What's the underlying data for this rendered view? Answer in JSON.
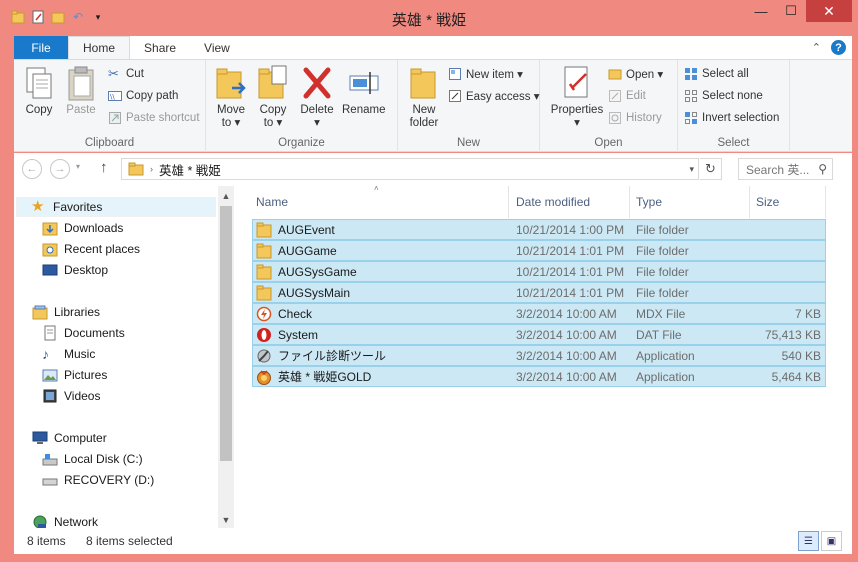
{
  "window": {
    "title": "英雄 * 戦姫",
    "controls": {
      "minimize": "—",
      "maximize": "☐",
      "close": "✕"
    }
  },
  "ribbon_tabs": [
    {
      "label": "File"
    },
    {
      "label": "Home"
    },
    {
      "label": "Share"
    },
    {
      "label": "View"
    }
  ],
  "ribbon": {
    "clipboard": {
      "group": "Clipboard",
      "copy": "Copy",
      "paste": "Paste",
      "cut": "Cut",
      "copy_path": "Copy path",
      "paste_shortcut": "Paste shortcut"
    },
    "organize": {
      "group": "Organize",
      "move_to": "Move to ▾",
      "copy_to": "Copy to ▾",
      "delete": "Delete ▾",
      "rename": "Rename"
    },
    "new": {
      "group": "New",
      "new_folder": "New folder",
      "new_item": "New item ▾",
      "easy_access": "Easy access ▾"
    },
    "open": {
      "group": "Open",
      "properties": "Properties ▾",
      "open": "Open ▾",
      "edit": "Edit",
      "history": "History"
    },
    "select": {
      "group": "Select",
      "select_all": "Select all",
      "select_none": "Select none",
      "invert_selection": "Invert selection"
    }
  },
  "address_bar": {
    "path": "英雄 * 戦姫",
    "search_placeholder": "Search 英..."
  },
  "nav_pane": {
    "favorites": "Favorites",
    "favorites_items": [
      "Downloads",
      "Recent places",
      "Desktop"
    ],
    "libraries": "Libraries",
    "libraries_items": [
      "Documents",
      "Music",
      "Pictures",
      "Videos"
    ],
    "computer": "Computer",
    "computer_items": [
      "Local Disk (C:)",
      "RECOVERY (D:)"
    ],
    "network": "Network"
  },
  "columns": {
    "name": "Name",
    "date": "Date modified",
    "type": "Type",
    "size": "Size"
  },
  "files": [
    {
      "name": "AUGEvent",
      "date": "10/21/2014 1:00 PM",
      "type": "File folder",
      "size": "",
      "icon": "folder-icon"
    },
    {
      "name": "AUGGame",
      "date": "10/21/2014 1:01 PM",
      "type": "File folder",
      "size": "",
      "icon": "folder-icon"
    },
    {
      "name": "AUGSysGame",
      "date": "10/21/2014 1:01 PM",
      "type": "File folder",
      "size": "",
      "icon": "folder-icon"
    },
    {
      "name": "AUGSysMain",
      "date": "10/21/2014 1:01 PM",
      "type": "File folder",
      "size": "",
      "icon": "folder-icon"
    },
    {
      "name": "Check",
      "date": "3/2/2014 10:00 AM",
      "type": "MDX File",
      "size": "7 KB",
      "icon": "mdx-file-icon"
    },
    {
      "name": "System",
      "date": "3/2/2014 10:00 AM",
      "type": "DAT File",
      "size": "75,413 KB",
      "icon": "dat-file-icon"
    },
    {
      "name": "ファイル診断ツール",
      "date": "3/2/2014 10:00 AM",
      "type": "Application",
      "size": "540 KB",
      "icon": "tool-app-icon"
    },
    {
      "name": "英雄 * 戦姫GOLD",
      "date": "3/2/2014 10:00 AM",
      "type": "Application",
      "size": "5,464 KB",
      "icon": "game-app-icon"
    }
  ],
  "status": {
    "item_count": "8 items",
    "selected": "8 items selected"
  },
  "colors": {
    "window_frame": "#f08a80",
    "file_tab": "#1979ca",
    "selection_fill": "#cce8f4",
    "selection_border": "#99d1ea",
    "close_button": "#c74040"
  }
}
